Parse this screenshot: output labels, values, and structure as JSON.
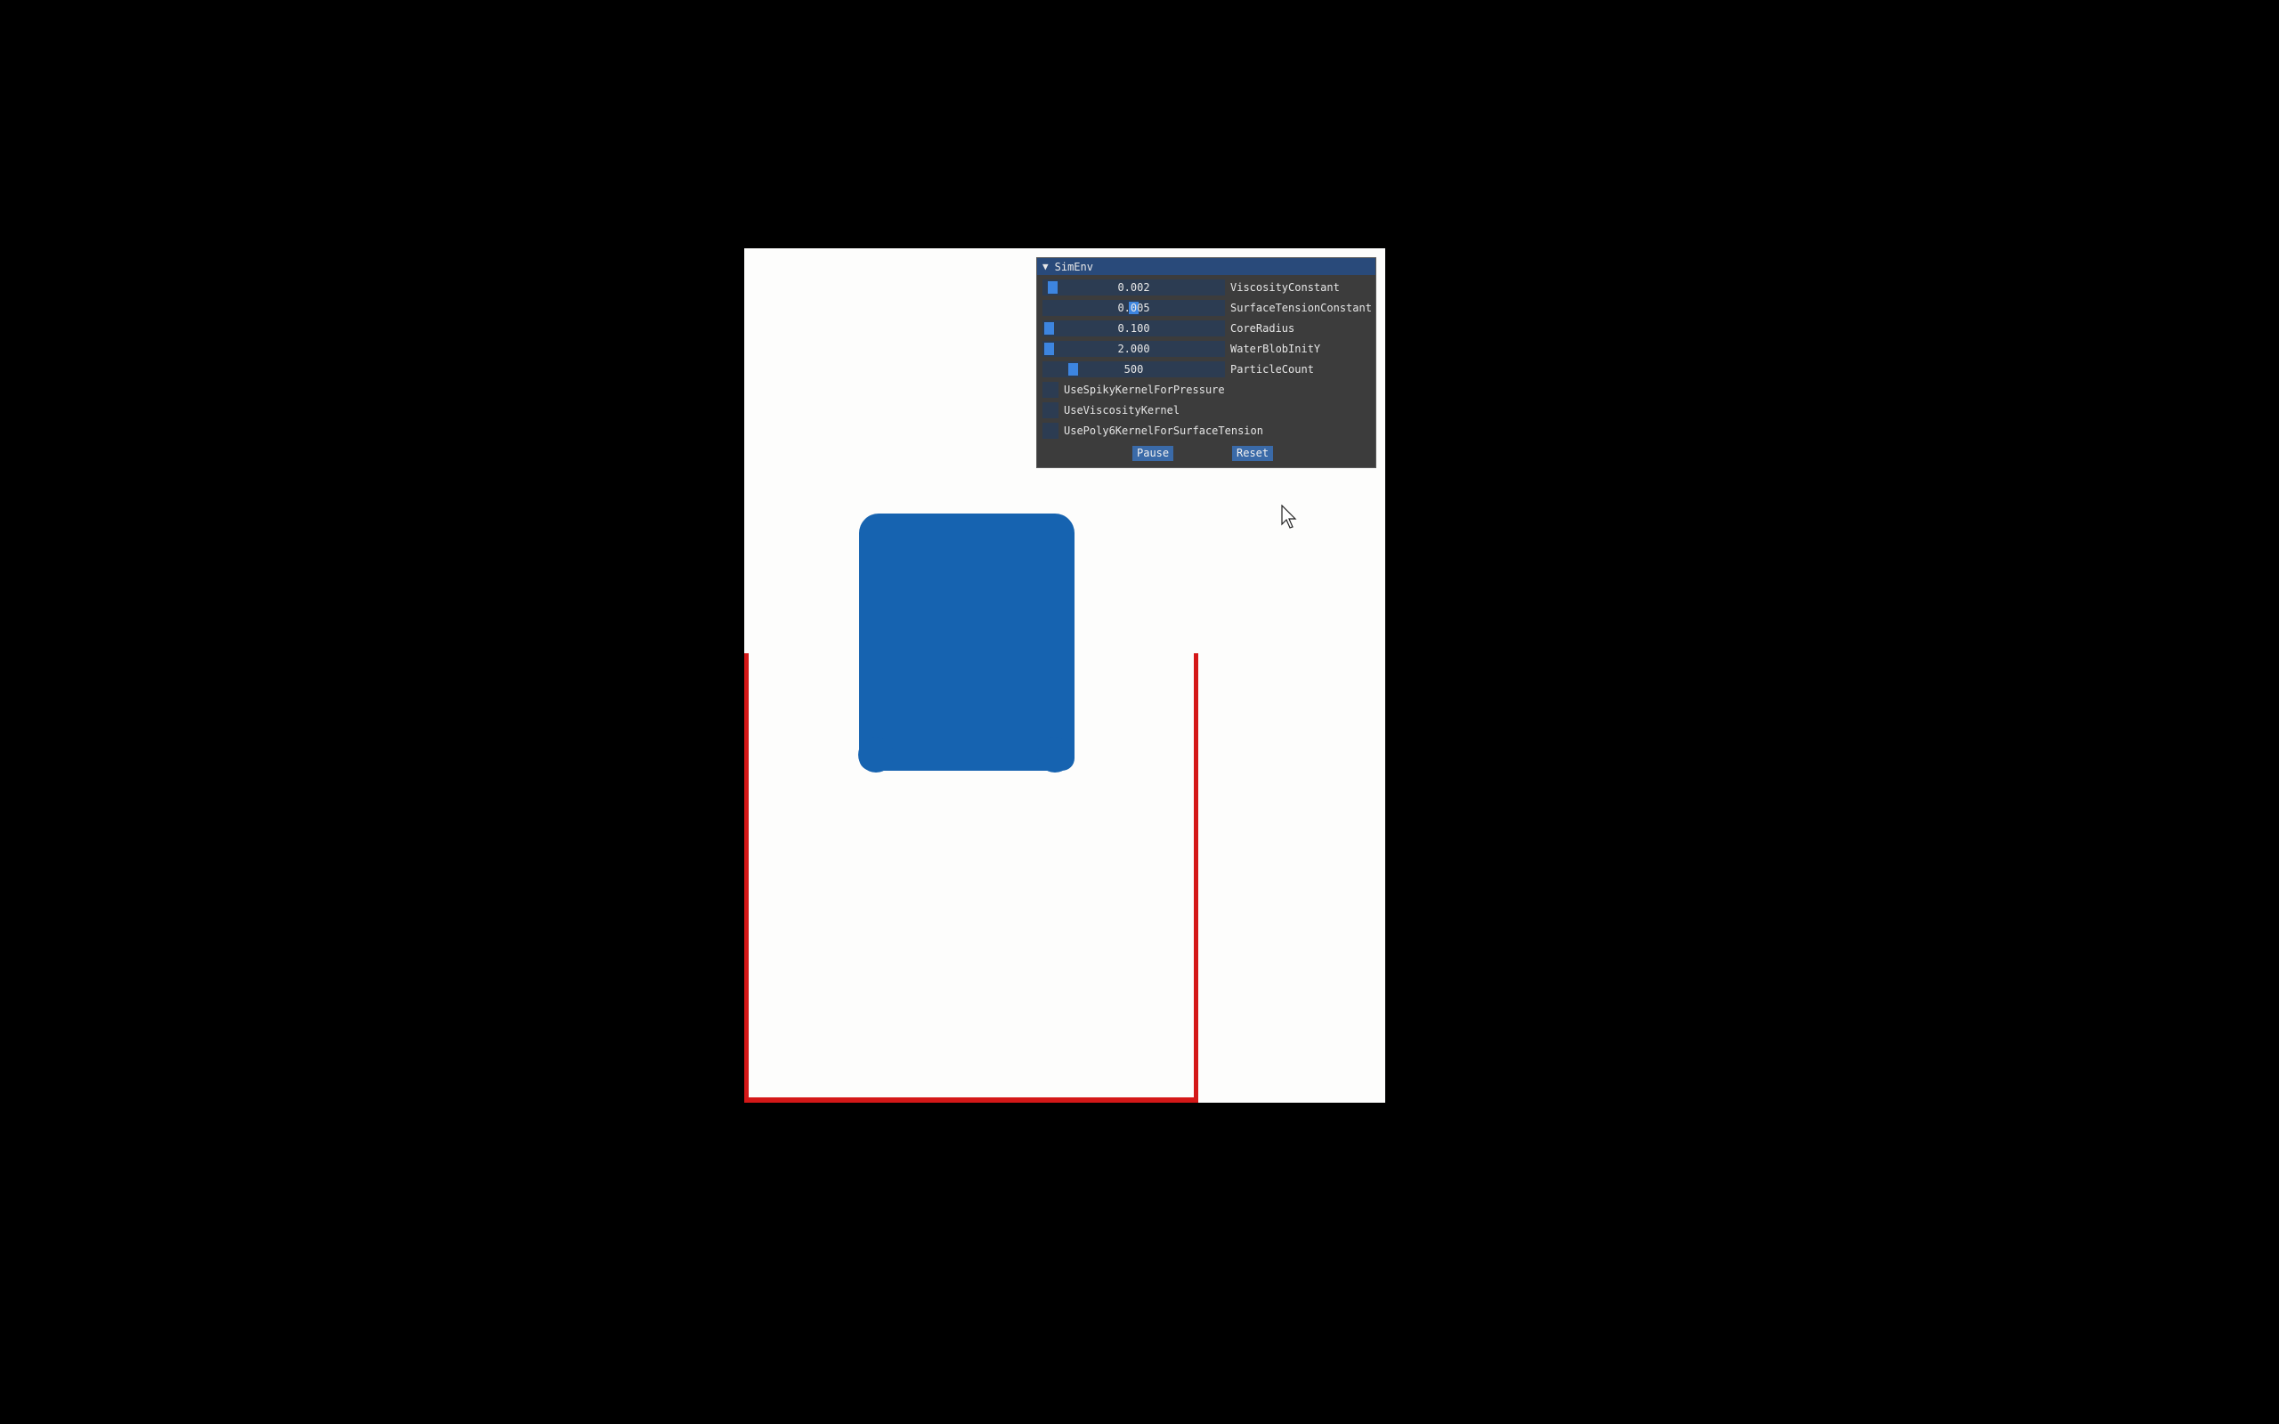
{
  "panel": {
    "title": "SimEnv",
    "collapse_arrow": "▼",
    "sliders": [
      {
        "value": "0.002",
        "label": "ViscosityConstant",
        "fraction": 0.02
      },
      {
        "value": "0.005",
        "label": "SurfaceTensionConstant",
        "fraction": 0.5
      },
      {
        "value": "0.100",
        "label": "CoreRadius",
        "fraction": 0.0
      },
      {
        "value": "2.000",
        "label": "WaterBlobInitY",
        "fraction": 0.0
      },
      {
        "value": "500",
        "label": "ParticleCount",
        "fraction": 0.14
      }
    ],
    "checkboxes": [
      {
        "label": "UseSpikyKernelForPressure",
        "checked": false
      },
      {
        "label": "UseViscosityKernel",
        "checked": false
      },
      {
        "label": "UsePoly6KernelForSurfaceTension",
        "checked": false
      }
    ],
    "pause_label": "Pause",
    "reset_label": "Reset"
  },
  "colors": {
    "water": "#1663b0",
    "wall": "#d41818",
    "background": "#fdfdfc",
    "panel_title": "#294a7a",
    "slider_grab": "#3d85e0"
  },
  "icons": {
    "cursor": "mouse-pointer-icon"
  }
}
